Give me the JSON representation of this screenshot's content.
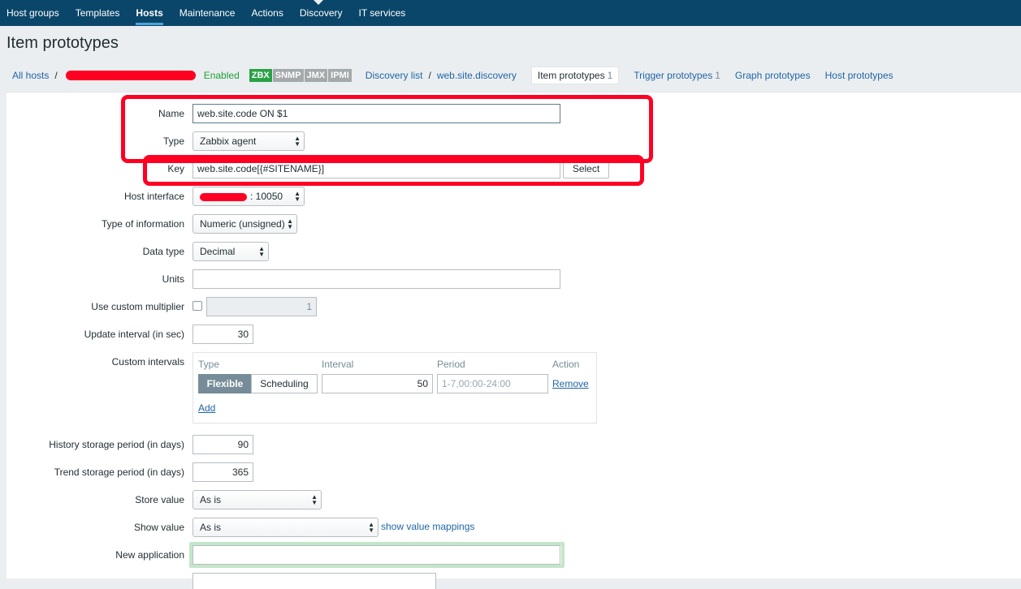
{
  "nav": {
    "items": [
      "Host groups",
      "Templates",
      "Hosts",
      "Maintenance",
      "Actions",
      "Discovery",
      "IT services"
    ],
    "active": "Hosts"
  },
  "page": {
    "title": "Item prototypes"
  },
  "breadcrumb": {
    "all_hosts": "All hosts",
    "sep": "/",
    "status": "Enabled",
    "badges": [
      "ZBX",
      "SNMP",
      "JMX",
      "IPMI"
    ],
    "discovery_list": "Discovery list",
    "discovery_rule": "web.site.discovery",
    "tabs": {
      "item_prototypes": "Item prototypes",
      "item_count": "1",
      "trigger_prototypes": "Trigger prototypes",
      "trigger_count": "1",
      "graph_prototypes": "Graph prototypes",
      "host_prototypes": "Host prototypes"
    }
  },
  "form": {
    "name": {
      "label": "Name",
      "value": "web.site.code ON $1"
    },
    "type": {
      "label": "Type",
      "value": "Zabbix agent"
    },
    "key": {
      "label": "Key",
      "value": "web.site.code[{#SITENAME}]",
      "button": "Select"
    },
    "host_interface": {
      "label": "Host interface",
      "value": ": 10050"
    },
    "type_of_information": {
      "label": "Type of information",
      "value": "Numeric (unsigned)"
    },
    "data_type": {
      "label": "Data type",
      "value": "Decimal"
    },
    "units": {
      "label": "Units",
      "value": ""
    },
    "custom_multiplier": {
      "label": "Use custom multiplier",
      "value": "1"
    },
    "update_interval": {
      "label": "Update interval (in sec)",
      "value": "30"
    },
    "custom_intervals": {
      "label": "Custom intervals",
      "headers": [
        "Type",
        "Interval",
        "Period",
        "Action"
      ],
      "row": {
        "flexible": "Flexible",
        "scheduling": "Scheduling",
        "interval": "50",
        "period": "1-7,00:00-24:00",
        "remove": "Remove"
      },
      "add": "Add"
    },
    "history": {
      "label": "History storage period (in days)",
      "value": "90"
    },
    "trends": {
      "label": "Trend storage period (in days)",
      "value": "365"
    },
    "store_value": {
      "label": "Store value",
      "value": "As is"
    },
    "show_value": {
      "label": "Show value",
      "value": "As is",
      "link": "show value mappings"
    },
    "new_application": {
      "label": "New application",
      "value": ""
    }
  },
  "colors": {
    "nav_bg": "#0a466a",
    "link": "#1f65a6",
    "enabled": "#1ba038",
    "zbx": "#2aa146",
    "annotation_red": "#ff0022"
  }
}
